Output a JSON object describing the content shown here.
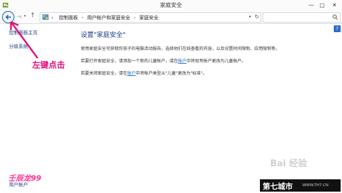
{
  "window": {
    "title": "家庭安全",
    "minimize": "—",
    "maximize": "□",
    "close": "✕"
  },
  "breadcrumb": [
    "控制面板",
    "用户帐户和家庭安全",
    "家庭安全"
  ],
  "sidebar": {
    "home_link": "控制面板主页",
    "parent_link": "分级系统",
    "see_also": "壬辰龙99",
    "user_accounts": "用户帐户"
  },
  "main": {
    "heading": "设置\"家庭安全\"",
    "para1": "使用家庭安全可获取你孩子的电脑活动报告，选择他们在线查看的内容，以及设置时间限制、应用限制等。",
    "para2_before": "若要打开家庭安全，请添加一个新的儿童帐户，或在",
    "para2_link": "帐户",
    "para2_after": "中将现有帐户更改为儿童帐户。",
    "para3_before": "若要关闭家庭安全，请在",
    "para3_link": "帐户",
    "para3_after": "中将帐户类型从\"儿童\"更改为\"标准\"。"
  },
  "annotation": "左键点击",
  "help": "?",
  "watermark": {
    "baidu": "Bai 经验",
    "site_name": "第七城市",
    "site_url": "WWW.TH7.CN"
  }
}
